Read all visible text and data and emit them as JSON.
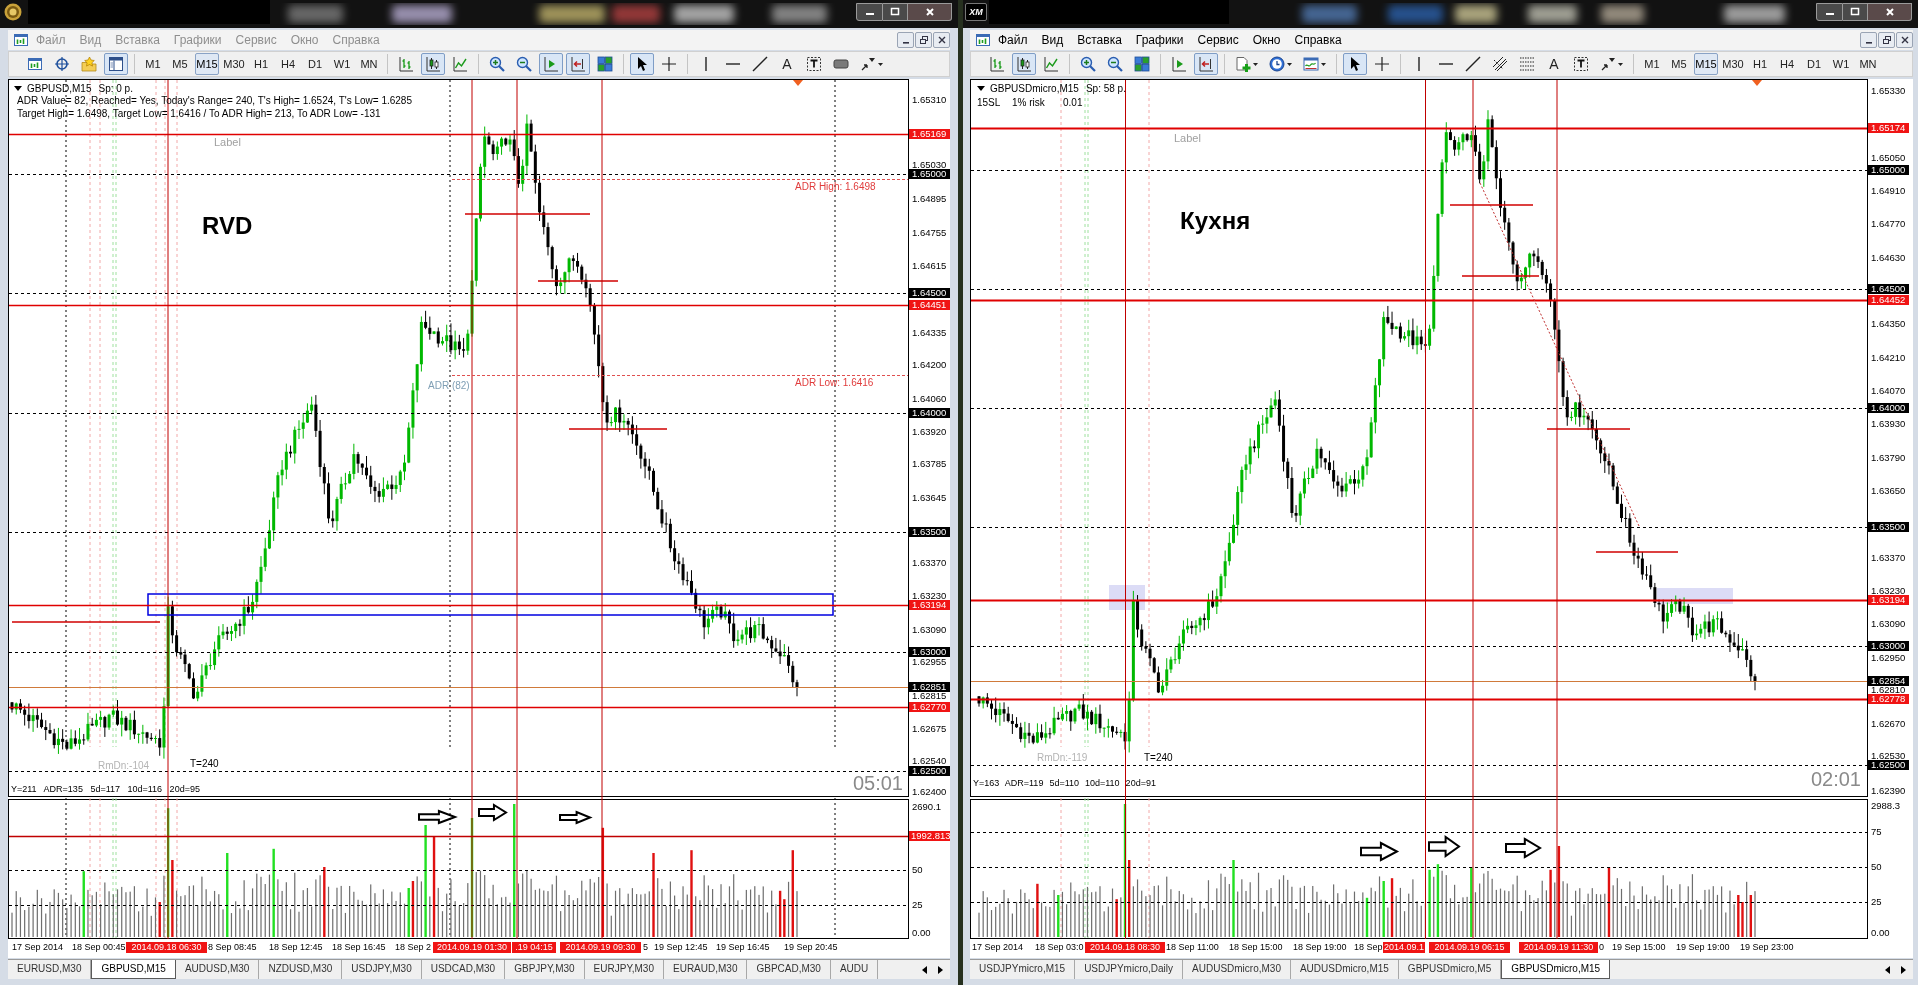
{
  "windows": [
    {
      "active": false,
      "logo": {
        "kind": "emblem"
      },
      "menu": [
        "Файл",
        "Вид",
        "Вставка",
        "Графики",
        "Сервис",
        "Окно",
        "Справка"
      ],
      "toolbar": {
        "navigator": true,
        "timeframes": [
          {
            "label": "M1",
            "selected": false
          },
          {
            "label": "M5",
            "selected": false
          },
          {
            "label": "M15",
            "selected": true
          },
          {
            "label": "M30",
            "selected": false
          },
          {
            "label": "H1",
            "selected": false
          },
          {
            "label": "H4",
            "selected": false
          },
          {
            "label": "D1",
            "selected": false
          },
          {
            "label": "W1",
            "selected": false
          },
          {
            "label": "MN",
            "selected": false
          }
        ],
        "chart_types": [
          {
            "kind": "bars",
            "selected": false
          },
          {
            "kind": "candles",
            "selected": true
          },
          {
            "kind": "line",
            "selected": false
          }
        ],
        "autoscroll": true,
        "chart_shift": true,
        "tools": [
          {
            "kind": "cursor",
            "selected": true
          },
          {
            "kind": "crosshair",
            "selected": false
          }
        ],
        "text_tool": "A"
      },
      "chart": {
        "symbol": "GBPUSD,M15",
        "spread": "Sp: 0 p.",
        "info_rows": [
          [
            "ADR Value= 82, Reached= Yes, Today's Range= 240, T's High= 1.6524, T's Low= 1.6285"
          ],
          [
            "Target High= 1.6498, Target Low= 1.6416 / To ADR High= 213, To ADR Low= -131"
          ]
        ],
        "texts": [
          {
            "kind": "label",
            "text": "Label"
          },
          {
            "kind": "title",
            "text": "RVD"
          },
          {
            "kind": "adr_high",
            "text": "ADR High: 1.6498"
          },
          {
            "kind": "adr_name",
            "text": "ADR (82)"
          },
          {
            "kind": "adr_low",
            "text": "ADR Low: 1.6416"
          },
          {
            "kind": "range",
            "text": "RmDn:-104"
          },
          {
            "kind": "target",
            "text": "T=240"
          }
        ],
        "stats": "Y=211 ADR=135 5d=117 10d=116 20d=95",
        "timer": "05:01",
        "price_ticks": [
          "1.65310",
          "1.65030",
          "1.64895",
          "1.64755",
          "1.64615",
          "1.64335",
          "1.64200",
          "1.64060",
          "1.63920",
          "1.63785",
          "1.63645",
          "1.63370",
          "1.63230",
          "1.63090",
          "1.62955",
          "1.62815",
          "1.62675",
          "1.62540",
          "1.62400"
        ],
        "price_tags": [
          {
            "label": "1.65169",
            "kind": "level"
          },
          {
            "label": "1.65000",
            "kind": "round"
          },
          {
            "label": "1.64500",
            "kind": "round"
          },
          {
            "label": "1.64451",
            "kind": "level"
          },
          {
            "label": "1.64000",
            "kind": "round"
          },
          {
            "label": "1.63500",
            "kind": "round"
          },
          {
            "label": "1.63194",
            "kind": "level"
          },
          {
            "label": "1.63000",
            "kind": "round"
          },
          {
            "label": "1.62851",
            "kind": "bid"
          },
          {
            "label": "1.62770",
            "kind": "level"
          },
          {
            "label": "1.62500",
            "kind": "round"
          }
        ],
        "volume_ticks": [
          {
            "label": "2690.1",
            "kind": "scale"
          },
          {
            "label": "50",
            "kind": "level"
          },
          {
            "label": "25",
            "kind": "level"
          },
          {
            "label": "0.00",
            "kind": "scale"
          }
        ],
        "volume_tags": [
          {
            "label": "1992.813",
            "kind": "level"
          }
        ],
        "time_labels": [
          {
            "text": "17 Sep 2014",
            "kind": "tick"
          },
          {
            "text": "18 Sep 00:45",
            "kind": "tick"
          },
          {
            "text": "2014.09.18 06:30",
            "kind": "marker"
          },
          {
            "text": "8 Sep 08:45",
            "kind": "tick"
          },
          {
            "text": "18 Sep 12:45",
            "kind": "tick"
          },
          {
            "text": "18 Sep 16:45",
            "kind": "tick"
          },
          {
            "text": "18 Sep 2",
            "kind": "tick"
          },
          {
            "text": "2014.09.19 01:30",
            "kind": "marker"
          },
          {
            "text": ".19 04:15",
            "kind": "marker"
          },
          {
            "text": "2014.09.19 09:30",
            "kind": "marker"
          },
          {
            "text": "5",
            "kind": "tick"
          },
          {
            "text": "19 Sep 12:45",
            "kind": "tick"
          },
          {
            "text": "19 Sep 16:45",
            "kind": "tick"
          },
          {
            "text": "19 Sep 20:45",
            "kind": "tick"
          }
        ]
      },
      "tabs": [
        {
          "label": "EURUSD,M30",
          "selected": false
        },
        {
          "label": "GBPUSD,M15",
          "selected": true
        },
        {
          "label": "AUDUSD,M30",
          "selected": false
        },
        {
          "label": "NZDUSD,M30",
          "selected": false
        },
        {
          "label": "USDJPY,M30",
          "selected": false
        },
        {
          "label": "USDCAD,M30",
          "selected": false
        },
        {
          "label": "GBPJPY,M30",
          "selected": false
        },
        {
          "label": "EURJPY,M30",
          "selected": false
        },
        {
          "label": "EURAUD,M30",
          "selected": false
        },
        {
          "label": "GBPCAD,M30",
          "selected": false
        },
        {
          "label": "AUDU",
          "selected": false
        }
      ]
    },
    {
      "active": true,
      "logo": {
        "kind": "badge",
        "text": "XM"
      },
      "menu": [
        "Файл",
        "Вид",
        "Вставка",
        "Графики",
        "Сервис",
        "Окно",
        "Справка"
      ],
      "toolbar": {
        "timeframes": [
          {
            "label": "M1",
            "selected": false
          },
          {
            "label": "M5",
            "selected": false
          },
          {
            "label": "M15",
            "selected": true
          },
          {
            "label": "M30",
            "selected": false
          },
          {
            "label": "H1",
            "selected": false
          },
          {
            "label": "H4",
            "selected": false
          },
          {
            "label": "D1",
            "selected": false
          },
          {
            "label": "W1",
            "selected": false
          },
          {
            "label": "MN",
            "selected": false
          }
        ],
        "chart_types": [
          {
            "kind": "bars",
            "selected": false
          },
          {
            "kind": "candles",
            "selected": true
          },
          {
            "kind": "line",
            "selected": false
          }
        ],
        "autoscroll": false,
        "chart_shift": true,
        "tools": [
          {
            "kind": "cursor",
            "selected": true
          },
          {
            "kind": "crosshair",
            "selected": false
          }
        ],
        "text_tool": "A"
      },
      "chart": {
        "symbol": "GBPUSDmicro,M15",
        "spread": "Sp: 58 p.",
        "info_rows": [
          [
            "15SL",
            "1% risk",
            "0.01"
          ]
        ],
        "texts": [
          {
            "kind": "label",
            "text": "Label"
          },
          {
            "kind": "title",
            "text": "Кухня"
          },
          {
            "kind": "range",
            "text": "RmDn:-119"
          },
          {
            "kind": "target",
            "text": "T=240"
          }
        ],
        "stats": "Y=163 ADR=119 5d=110 10d=110 20d=91",
        "timer": "02:01",
        "price_ticks": [
          "1.65330",
          "1.65050",
          "1.64910",
          "1.64770",
          "1.64630",
          "1.64350",
          "1.64210",
          "1.64070",
          "1.63930",
          "1.63790",
          "1.63650",
          "1.63370",
          "1.63230",
          "1.63090",
          "1.62950",
          "1.62810",
          "1.62670",
          "1.62530",
          "1.62390"
        ],
        "price_tags": [
          {
            "label": "1.65174",
            "kind": "level"
          },
          {
            "label": "1.65000",
            "kind": "round"
          },
          {
            "label": "1.64500",
            "kind": "round"
          },
          {
            "label": "1.64452",
            "kind": "level"
          },
          {
            "label": "1.64000",
            "kind": "round"
          },
          {
            "label": "1.63500",
            "kind": "round"
          },
          {
            "label": "1.63194",
            "kind": "level"
          },
          {
            "label": "1.63000",
            "kind": "round"
          },
          {
            "label": "1.62854",
            "kind": "bid"
          },
          {
            "label": "1.62778",
            "kind": "level"
          },
          {
            "label": "1.62500",
            "kind": "round"
          }
        ],
        "volume_ticks": [
          {
            "label": "2988.3",
            "kind": "scale"
          },
          {
            "label": "75",
            "kind": "level"
          },
          {
            "label": "50",
            "kind": "level"
          },
          {
            "label": "25",
            "kind": "level"
          },
          {
            "label": "0.00",
            "kind": "scale"
          }
        ],
        "time_labels": [
          {
            "text": "17 Sep 2014",
            "kind": "tick"
          },
          {
            "text": "18 Sep 03:0",
            "kind": "tick"
          },
          {
            "text": "2014.09.18 08:30",
            "kind": "marker"
          },
          {
            "text": "18 Sep 11:00",
            "kind": "tick"
          },
          {
            "text": "18 Sep 15:00",
            "kind": "tick"
          },
          {
            "text": "18 Sep 19:00",
            "kind": "tick"
          },
          {
            "text": "18 Sep",
            "kind": "tick"
          },
          {
            "text": "2014.09.1",
            "kind": "marker"
          },
          {
            "text": "2014.09.19 06:15",
            "kind": "marker"
          },
          {
            "text": "2014.09.19 11:30",
            "kind": "marker"
          },
          {
            "text": "0",
            "kind": "tick"
          },
          {
            "text": "19 Sep 15:00",
            "kind": "tick"
          },
          {
            "text": "19 Sep 19:00",
            "kind": "tick"
          },
          {
            "text": "19 Sep 23:00",
            "kind": "tick"
          }
        ]
      },
      "tabs": [
        {
          "label": "USDJPYmicro,M15",
          "selected": false
        },
        {
          "label": "USDJPYmicro,Daily",
          "selected": false
        },
        {
          "label": "AUDUSDmicro,M30",
          "selected": false
        },
        {
          "label": "AUDUSDmicro,M15",
          "selected": false
        },
        {
          "label": "GBPUSDmicro,M5",
          "selected": false
        },
        {
          "label": "GBPUSDmicro,M15",
          "selected": true
        }
      ]
    }
  ]
}
